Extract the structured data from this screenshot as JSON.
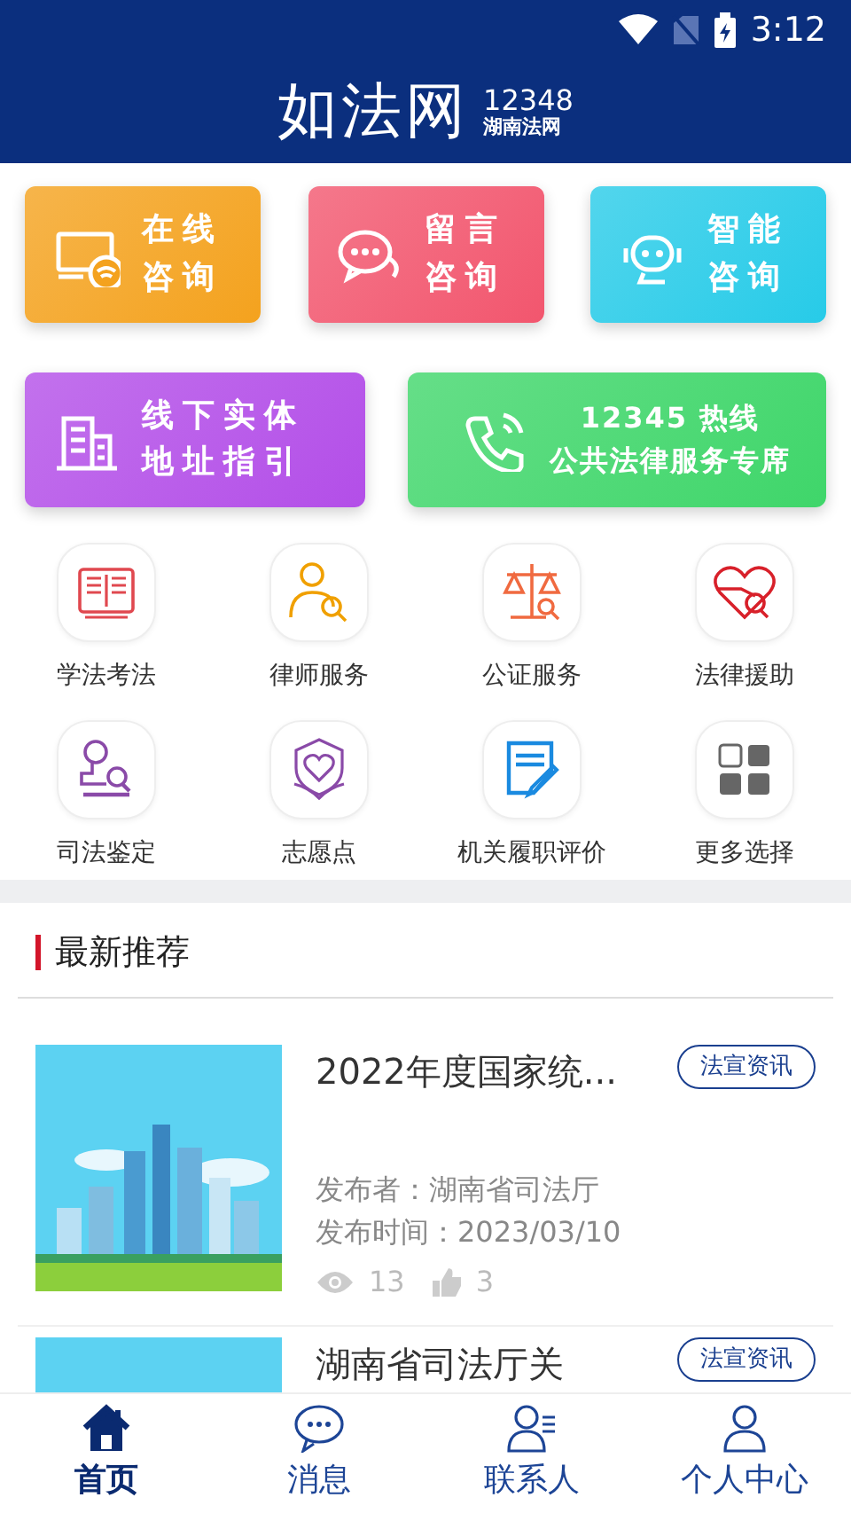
{
  "status_bar": {
    "time": "3:12"
  },
  "header": {
    "logo": "如法网",
    "hotline": "12348",
    "site": "湖南法网"
  },
  "quick_tiles": [
    {
      "lines": [
        "在线",
        "咨询"
      ],
      "color": "#f4a21e"
    },
    {
      "lines": [
        "留言",
        "咨询"
      ],
      "color": "#f2566e"
    },
    {
      "lines": [
        "智能",
        "咨询"
      ],
      "color": "#27cbe8"
    },
    {
      "lines": [
        "线下实体",
        "地址指引"
      ],
      "color": "#b34ee8"
    },
    {
      "lines": [
        "12345 热线",
        "公共法律服务专席"
      ],
      "color": "#3fd66a"
    }
  ],
  "services": [
    "学法考法",
    "律师服务",
    "公证服务",
    "法律援助",
    "司法鉴定",
    "志愿点",
    "机关履职评价",
    "更多选择"
  ],
  "section_title": "最新推荐",
  "articles": [
    {
      "title": "2022年度国家统...",
      "tag": "法宣资讯",
      "publisher": "发布者：湖南省司法厅",
      "time": "发布时间：2023/03/10",
      "views": "13",
      "likes": "3"
    },
    {
      "title": "湖南省司法厅关",
      "tag": "法宣资讯"
    }
  ],
  "bottom_nav": [
    {
      "label": "首页",
      "selected": true
    },
    {
      "label": "消息",
      "selected": false
    },
    {
      "label": "联系人",
      "selected": false
    },
    {
      "label": "个人中心",
      "selected": false
    }
  ]
}
